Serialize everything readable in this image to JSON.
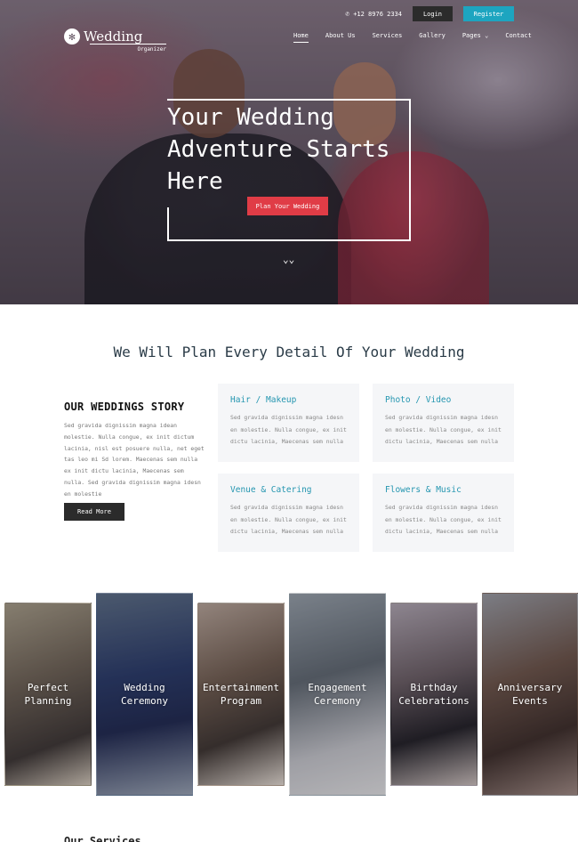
{
  "header": {
    "phone": "+12 8976 2334",
    "login_label": "Login",
    "register_label": "Register",
    "logo_title": "Wedding",
    "logo_sub": "Organizer",
    "nav": [
      {
        "label": "Home"
      },
      {
        "label": "About Us"
      },
      {
        "label": "Services"
      },
      {
        "label": "Gallery"
      },
      {
        "label": "Pages ⌄"
      },
      {
        "label": "Contact"
      }
    ]
  },
  "hero": {
    "heading": "Your Wedding Adventure Starts Here",
    "button": "Plan Your Wedding",
    "scroll_glyph": "⌄⌄"
  },
  "plan": {
    "title": "We Will Plan Every Detail Of Your Wedding",
    "story_title": "OUR WEDDINGS STORY",
    "story_text": "Sed gravida dignissim magna idean molestie. Nulla congue, ex init dictum lacinia, nisl est posuere nulla, net eget tas leo mi Sd lorem. Maecenas sem nulla ex init dictu lacinia, Maecenas sem nulla. Sed gravida dignissim magna idesn en molestie",
    "read_more": "Read More",
    "services": [
      {
        "title": "Hair / Makeup",
        "text": "Sed gravida dignissim magna idesn en molestie. Nulla congue, ex init dictu lacinia, Maecenas sem nulla"
      },
      {
        "title": "Photo / Video",
        "text": "Sed gravida dignissim magna idesn en molestie. Nulla congue, ex init dictu lacinia, Maecenas sem nulla"
      },
      {
        "title": "Venue & Catering",
        "text": "Sed gravida dignissim magna idesn en molestie. Nulla congue, ex init dictu lacinia, Maecenas sem nulla"
      },
      {
        "title": "Flowers & Music",
        "text": "Sed gravida dignissim magna idesn en molestie. Nulla congue, ex init dictu lacinia, Maecenas sem nulla"
      }
    ]
  },
  "cards": [
    {
      "line1": "Perfect",
      "line2": "Planning"
    },
    {
      "line1": "Wedding",
      "line2": "Ceremony"
    },
    {
      "line1": "Entertainment",
      "line2": "Program"
    },
    {
      "line1": "Engagement",
      "line2": "Ceremony"
    },
    {
      "line1": "Birthday",
      "line2": "Celebrations"
    },
    {
      "line1": "Anniversary",
      "line2": "Events"
    }
  ],
  "next_section_title": "Our Services",
  "colors": {
    "accent_red": "#e03c46",
    "accent_teal": "#1da5c0",
    "dark_button": "#2b2b2b"
  }
}
